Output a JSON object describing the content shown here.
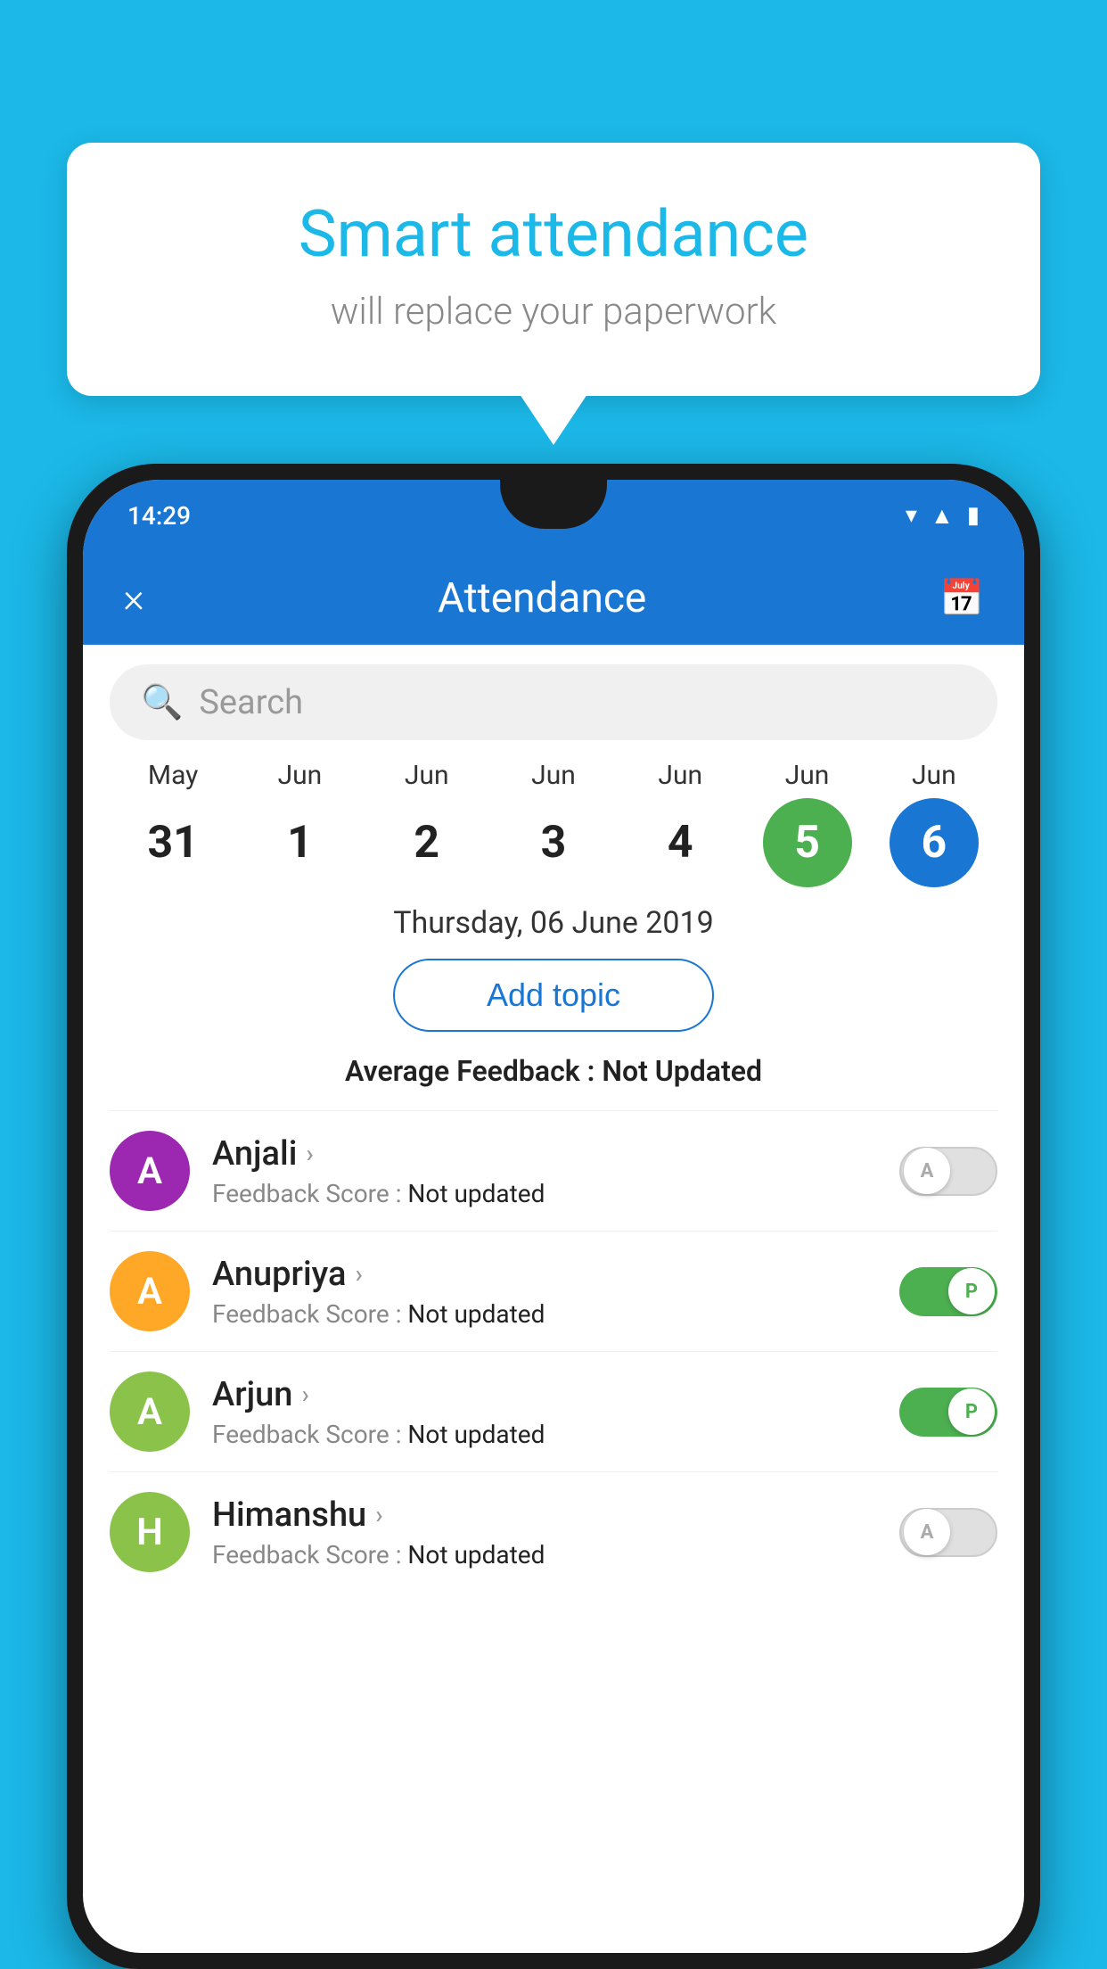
{
  "background_color": "#1BB8E8",
  "speech_bubble": {
    "title": "Smart attendance",
    "subtitle": "will replace your paperwork"
  },
  "status_bar": {
    "time": "14:29",
    "icons": [
      "wifi",
      "signal",
      "battery"
    ]
  },
  "app_header": {
    "title": "Attendance",
    "close_label": "×",
    "calendar_icon": "📅"
  },
  "search": {
    "placeholder": "Search"
  },
  "dates": [
    {
      "month": "May",
      "day": "31",
      "style": "normal"
    },
    {
      "month": "Jun",
      "day": "1",
      "style": "normal"
    },
    {
      "month": "Jun",
      "day": "2",
      "style": "normal"
    },
    {
      "month": "Jun",
      "day": "3",
      "style": "normal"
    },
    {
      "month": "Jun",
      "day": "4",
      "style": "normal"
    },
    {
      "month": "Jun",
      "day": "5",
      "style": "green"
    },
    {
      "month": "Jun",
      "day": "6",
      "style": "blue"
    }
  ],
  "selected_date": "Thursday, 06 June 2019",
  "add_topic_label": "Add topic",
  "average_feedback_label": "Average Feedback : ",
  "average_feedback_value": "Not Updated",
  "students": [
    {
      "name": "Anjali",
      "avatar_letter": "A",
      "avatar_color": "#9C27B0",
      "feedback_label": "Feedback Score : ",
      "feedback_value": "Not updated",
      "toggle": "off",
      "toggle_letter": "A"
    },
    {
      "name": "Anupriya",
      "avatar_letter": "A",
      "avatar_color": "#FFA726",
      "feedback_label": "Feedback Score : ",
      "feedback_value": "Not updated",
      "toggle": "on",
      "toggle_letter": "P"
    },
    {
      "name": "Arjun",
      "avatar_letter": "A",
      "avatar_color": "#8BC34A",
      "feedback_label": "Feedback Score : ",
      "feedback_value": "Not updated",
      "toggle": "on",
      "toggle_letter": "P"
    },
    {
      "name": "Himanshu",
      "avatar_letter": "H",
      "avatar_color": "#8BC34A",
      "feedback_label": "Feedback Score : ",
      "feedback_value": "Not updated",
      "toggle": "off",
      "toggle_letter": "A"
    }
  ]
}
